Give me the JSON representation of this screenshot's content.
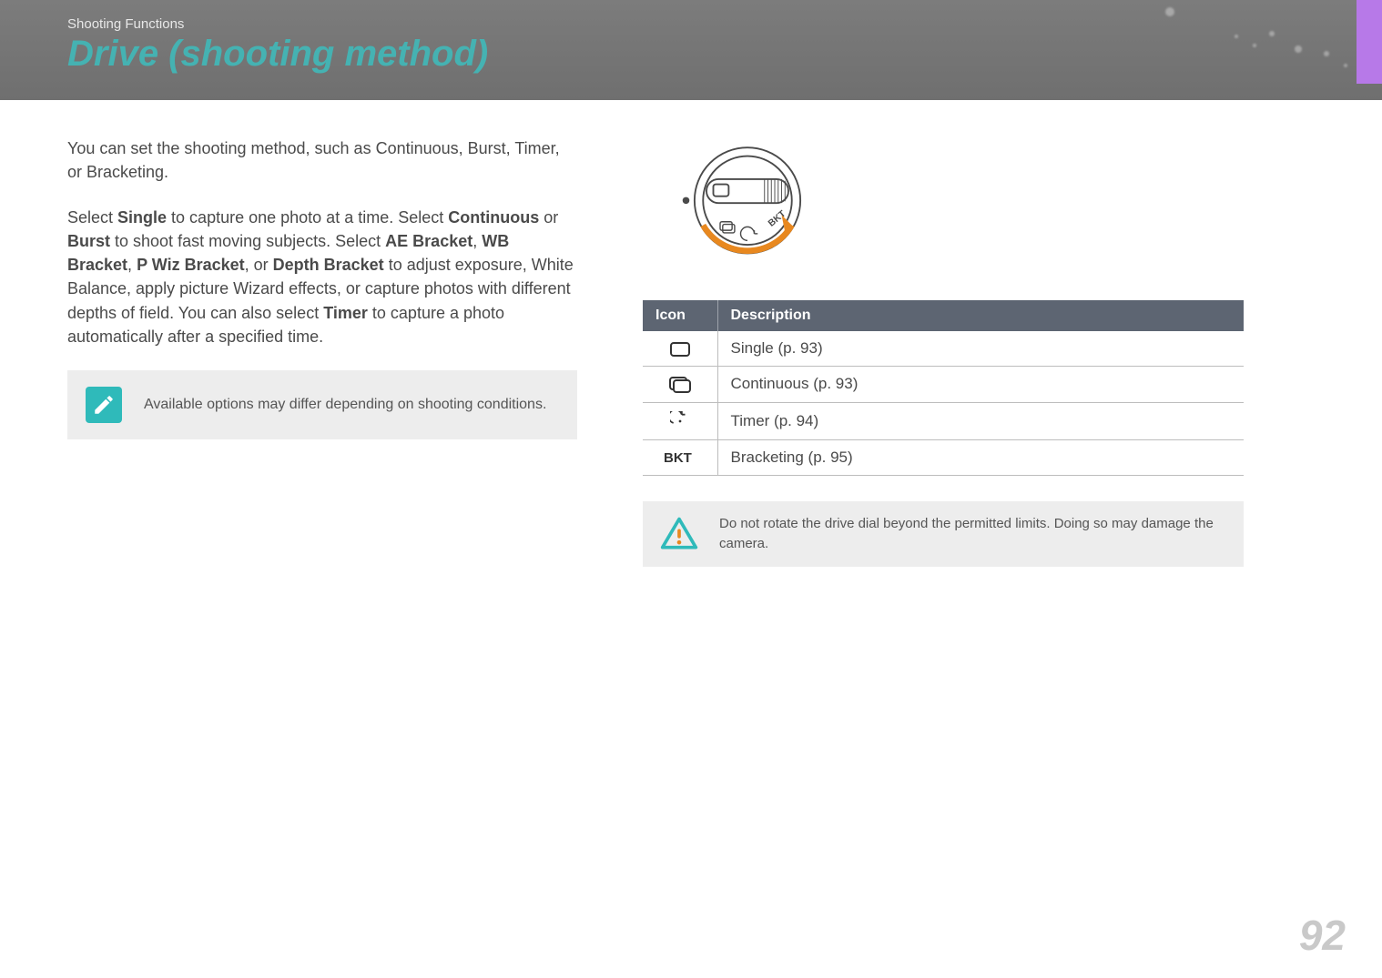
{
  "header": {
    "breadcrumb": "Shooting Functions",
    "title": "Drive (shooting method)"
  },
  "left": {
    "intro1": "You can set the shooting method, such as Continuous, Burst, Timer, or Bracketing.",
    "intro2_pre": "Select ",
    "b_single": "Single",
    "intro2_a": " to capture one photo at a time. Select ",
    "b_cont": "Continuous",
    "intro2_or": " or ",
    "b_burst": "Burst",
    "intro2_b": " to shoot fast moving subjects. Select ",
    "b_ae": "AE Bracket",
    "comma1": ", ",
    "b_wb": "WB Bracket",
    "comma2": ", ",
    "b_pwiz": "P Wiz Bracket",
    "comma3": ", or ",
    "b_depth": "Depth Bracket",
    "intro2_c": " to adjust exposure, White Balance, apply picture Wizard effects, or capture photos with different depths of field. You can also select ",
    "b_timer": "Timer",
    "intro2_d": " to capture a photo automatically after a specified time.",
    "note": "Available options may differ depending on shooting conditions."
  },
  "table": {
    "h_icon": "Icon",
    "h_desc": "Description",
    "rows": [
      {
        "icon": "single",
        "desc": "Single (p. 93)"
      },
      {
        "icon": "continuous",
        "desc": "Continuous (p. 93)"
      },
      {
        "icon": "timer",
        "desc": "Timer (p. 94)"
      },
      {
        "icon": "bracketing",
        "desc": "Bracketing (p. 95)"
      }
    ]
  },
  "warning": "Do not rotate the drive dial beyond the permitted limits. Doing so may damage the camera.",
  "pagenum": "92"
}
